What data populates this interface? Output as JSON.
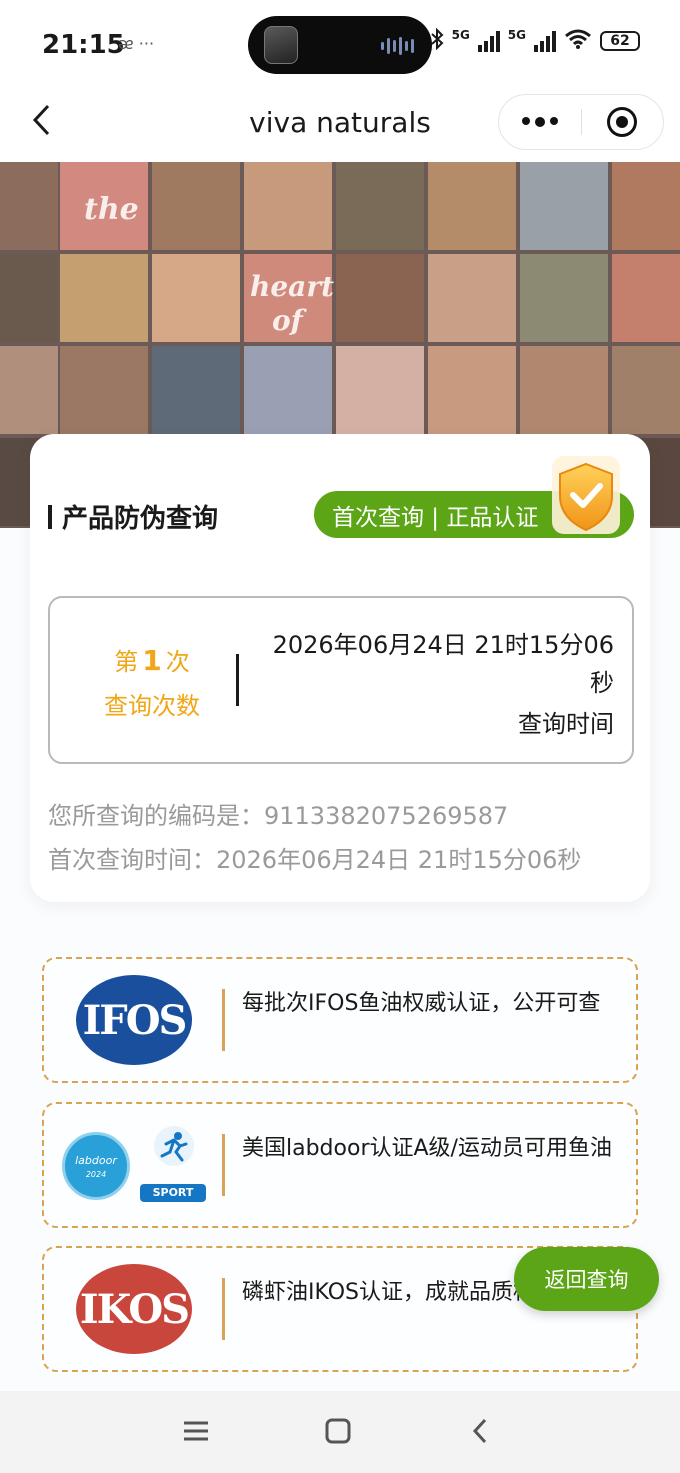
{
  "status_bar": {
    "time": "21:15",
    "extra": "ᴂ ···",
    "net1": "5G",
    "net2": "5G",
    "battery": "62"
  },
  "nav": {
    "title": "viva naturals",
    "back_icon": "chevron-left-icon",
    "more_icon": "more-dots-icon",
    "close_icon": "target-icon"
  },
  "banner": {
    "word_the": "the",
    "word_heart": "heart",
    "word_of": "of"
  },
  "verify": {
    "title": "产品防伪查询",
    "badge": "首次查询 | 正品认证",
    "count_prefix": "第",
    "count_value": "1",
    "count_suffix": "次",
    "count_label": "查询次数",
    "time_value": "2026年06月24日 21时15分06秒",
    "time_label": "查询时间",
    "code_line": "您所查询的编码是：9113382075269587",
    "first_line": "首次查询时间：2026年06月24日 21时15分06秒"
  },
  "certs": [
    {
      "logo": "IFOS",
      "text": "每批次IFOS鱼油权威认证，公开可查"
    },
    {
      "logo": "labdoor",
      "logo_year": "2024",
      "sport": "SPORT",
      "text": "美国labdoor认证A级/运动员可用鱼油"
    },
    {
      "logo": "IKOS",
      "text": "磷虾油IKOS认证，成就品质标杆"
    }
  ],
  "back_button": "返回查询",
  "colors": {
    "green": "#5ba516",
    "orange": "#f0a616",
    "gold_border": "#d8a451"
  }
}
